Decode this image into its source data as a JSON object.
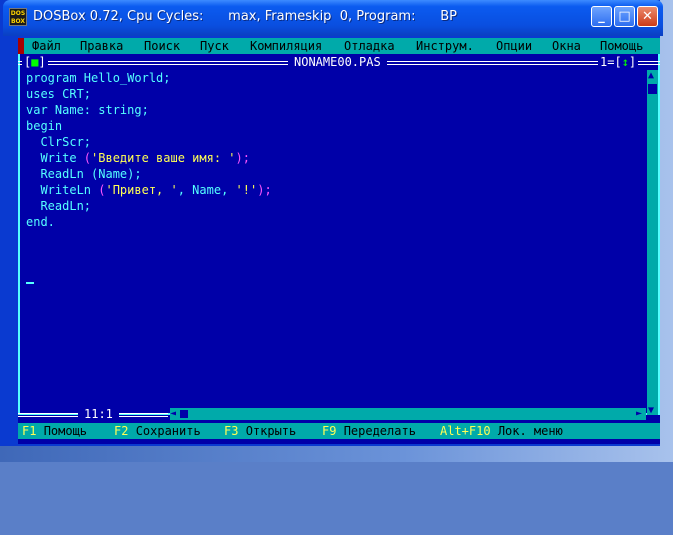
{
  "window": {
    "title": "DOSBox 0.72, Cpu Cycles:      max, Frameskip  0, Program:      BP",
    "app_icon_top": "DOS",
    "app_icon_bottom": "BOX",
    "buttons": {
      "minimize": "_",
      "maximize": "□",
      "close": "✕"
    }
  },
  "menu": [
    "Файл",
    "Правка",
    "Поиск",
    "Пуск",
    "Компиляция",
    "Отладка",
    "Инструм.",
    "Опции",
    "Окна",
    "Помощь"
  ],
  "editor_frame": {
    "close_left": "[",
    "close_mark": "■",
    "close_right": "]",
    "file_name": "NONAME00.PAS",
    "window_number": "1=[",
    "zoom_mark": "↕",
    "window_number_end": "]"
  },
  "code": [
    [
      {
        "t": "program Hello_World;",
        "c": "n"
      }
    ],
    [
      {
        "t": "uses CRT;",
        "c": "n"
      }
    ],
    [
      {
        "t": "var Name: string;",
        "c": "n"
      }
    ],
    [
      {
        "t": "begin",
        "c": "n"
      }
    ],
    [
      {
        "t": "  ClrScr;",
        "c": "n"
      }
    ],
    [
      {
        "t": "  Write ",
        "c": "n"
      },
      {
        "t": "(",
        "c": "s"
      },
      {
        "t": "'Введите ваше имя: '",
        "c": "q"
      },
      {
        "t": ");",
        "c": "s"
      }
    ],
    [
      {
        "t": "  ReadLn (Name);",
        "c": "n"
      }
    ],
    [
      {
        "t": "  WriteLn ",
        "c": "n"
      },
      {
        "t": "(",
        "c": "s"
      },
      {
        "t": "'Привет, '",
        "c": "q"
      },
      {
        "t": ", Name, ",
        "c": "n"
      },
      {
        "t": "'!'",
        "c": "q"
      },
      {
        "t": ");",
        "c": "s"
      }
    ],
    [
      {
        "t": "  ReadLn;",
        "c": "n"
      }
    ],
    [
      {
        "t": "end.",
        "c": "n"
      }
    ]
  ],
  "status": {
    "cursor_position": "11:1",
    "scroll_up": "▲",
    "scroll_down": "▼",
    "scroll_left": "◄",
    "scroll_right": "►"
  },
  "hotkeys": [
    {
      "key": "F1",
      "label": "Помощь"
    },
    {
      "key": "F2",
      "label": "Сохранить"
    },
    {
      "key": "F3",
      "label": "Открыть"
    },
    {
      "key": "F9",
      "label": "Переделать"
    },
    {
      "key": "Alt+F10",
      "label": "Лок. меню"
    }
  ],
  "colors": {
    "dos_background": "#0000a8",
    "menu_background": "#00aaaa",
    "code_text": "#55ffff",
    "string_literal": "#ffff55",
    "punctuation": "#ff55ff",
    "hotkey": "#ffff55"
  }
}
